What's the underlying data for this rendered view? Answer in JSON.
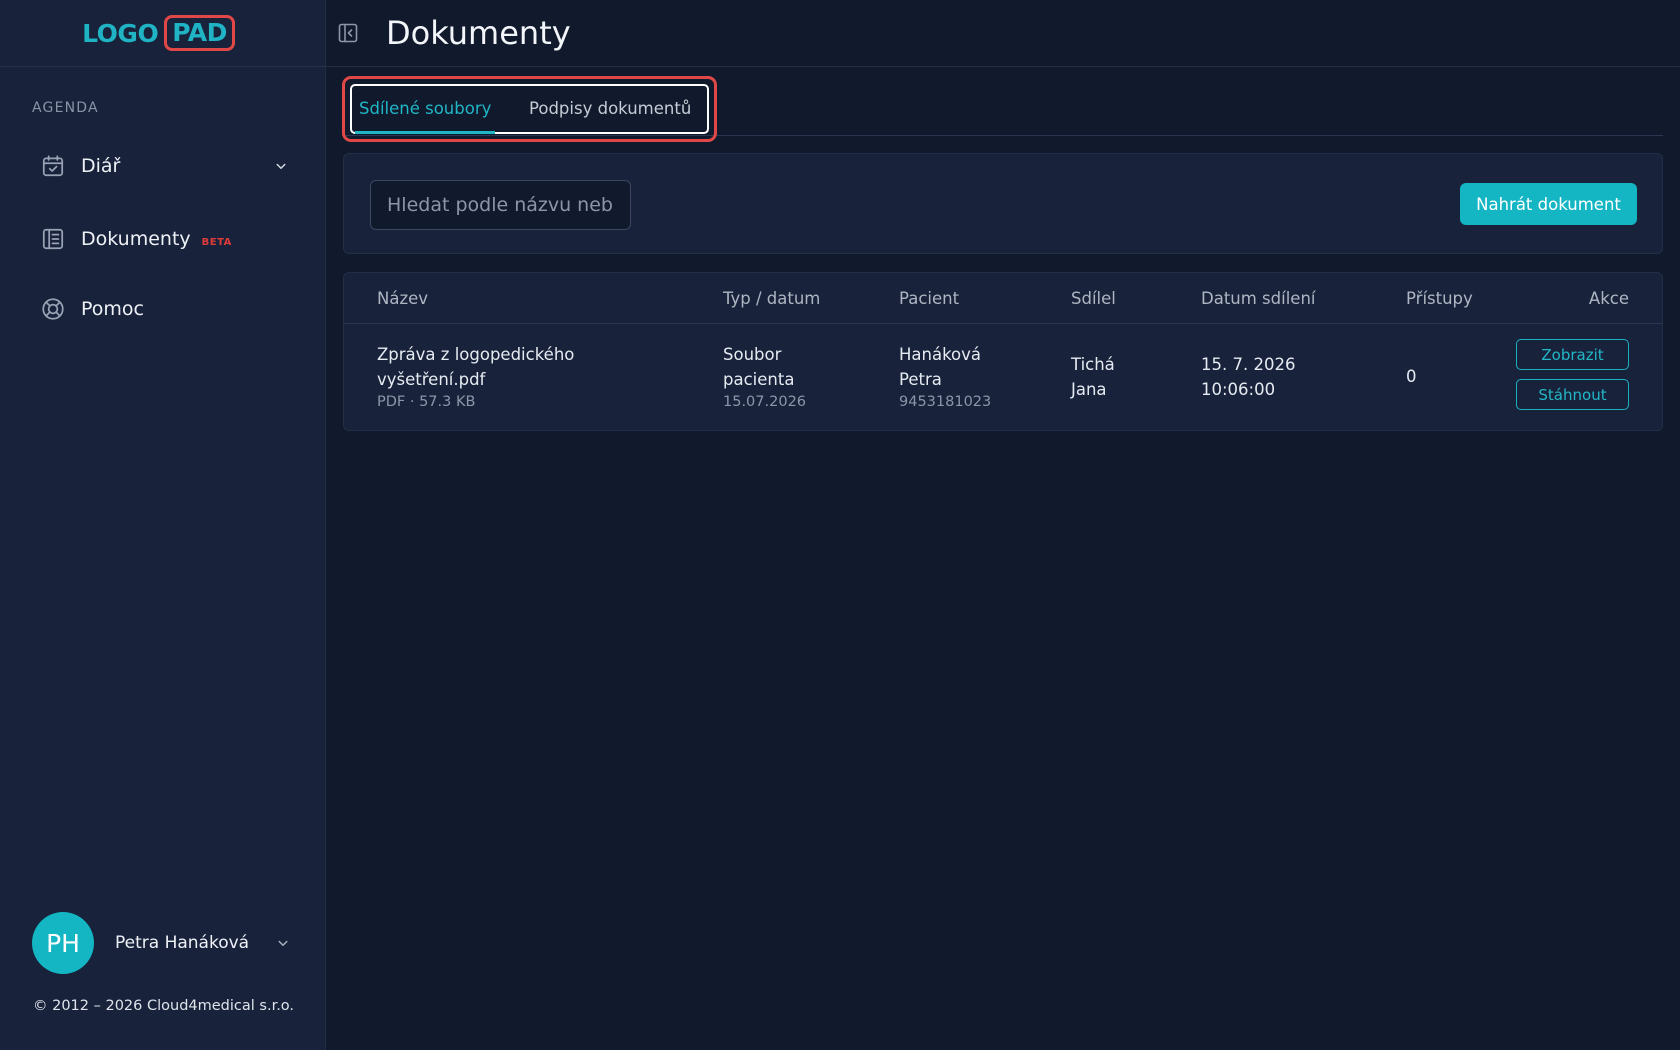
{
  "logo": {
    "part1": "LOGO",
    "part2": "PAD"
  },
  "sidebar": {
    "section_label": "AGENDA",
    "items": [
      {
        "label": "Diář",
        "icon": "calendar-check-icon"
      },
      {
        "label": "Dokumenty",
        "icon": "document-list-icon",
        "badge": "BETA"
      },
      {
        "label": "Pomoc",
        "icon": "lifebuoy-icon"
      }
    ]
  },
  "user": {
    "initials": "PH",
    "name": "Petra Hanáková"
  },
  "footer": {
    "copyright": "© 2012 – 2026 Cloud4medical s.r.o."
  },
  "header": {
    "title": "Dokumenty"
  },
  "tabs": [
    {
      "label": "Sdílené soubory",
      "active": true
    },
    {
      "label": "Podpisy dokumentů",
      "active": false
    }
  ],
  "toolbar": {
    "search_placeholder": "Hledat podle názvu nebo",
    "upload_label": "Nahrát dokument"
  },
  "table": {
    "columns": [
      "Název",
      "Typ / datum",
      "Pacient",
      "Sdílel",
      "Datum sdílení",
      "Přístupy",
      "Akce"
    ],
    "rows": [
      {
        "name_line1": "Zpráva z logopedického",
        "name_line2": "vyšetření.pdf",
        "name_meta": "PDF · 57.3 KB",
        "type_line1": "Soubor",
        "type_line2": "pacienta",
        "type_date": "15.07.2026",
        "patient_line1": "Hanáková",
        "patient_line2": "Petra",
        "patient_id": "9453181023",
        "shared_by_line1": "Tichá",
        "shared_by_line2": "Jana",
        "shared_date_line1": "15. 7. 2026",
        "shared_date_line2": "10:06:00",
        "access_count": "0",
        "view_label": "Zobrazit",
        "download_label": "Stáhnout"
      }
    ]
  },
  "colors": {
    "accent": "#14b6c4",
    "sidebar_bg": "#18223a",
    "main_bg": "#111a2c",
    "highlight_red": "#e04848",
    "beta_red": "#e03b3b"
  }
}
